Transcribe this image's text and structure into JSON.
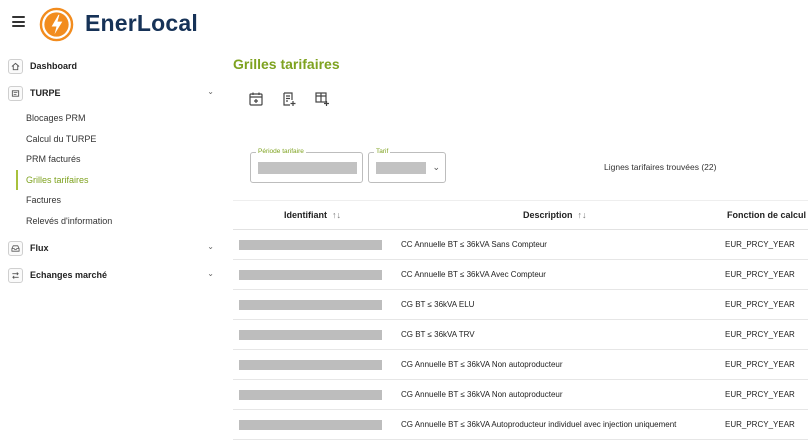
{
  "app": {
    "brand": "EnerLocal"
  },
  "sidebar": {
    "items": [
      {
        "label": "Dashboard",
        "icon": "home-icon"
      },
      {
        "label": "TURPE",
        "icon": "document-icon",
        "children": [
          "Blocages PRM",
          "Calcul du TURPE",
          "PRM facturés",
          "Grilles tarifaires",
          "Factures",
          "Relevés d'information"
        ],
        "active_child": "Grilles tarifaires"
      },
      {
        "label": "Flux",
        "icon": "inbox-icon"
      },
      {
        "label": "Echanges marché",
        "icon": "swap-arrows-icon"
      }
    ]
  },
  "page": {
    "title": "Grilles tarifaires",
    "toolbar": [
      "calendar-add-icon",
      "document-add-icon",
      "table-add-icon"
    ],
    "filters": {
      "periode_label": "Période tarifaire",
      "tarif_label": "Tarif"
    },
    "results_count": "Lignes tarifaires trouvées (22)"
  },
  "table": {
    "columns": [
      {
        "label": "Identifiant",
        "sortable": true
      },
      {
        "label": "Description",
        "sortable": true
      },
      {
        "label": "Fonction de calcul",
        "sortable": false
      }
    ],
    "sort_glyph": "↑↓",
    "rows": [
      {
        "description": "CC Annuelle BT ≤ 36kVA Sans Compteur",
        "fonction": "EUR_PRCY_YEAR"
      },
      {
        "description": "CC Annuelle BT ≤ 36kVA Avec Compteur",
        "fonction": "EUR_PRCY_YEAR"
      },
      {
        "description": "CG BT ≤ 36kVA ELU",
        "fonction": "EUR_PRCY_YEAR"
      },
      {
        "description": "CG BT ≤ 36kVA TRV",
        "fonction": "EUR_PRCY_YEAR"
      },
      {
        "description": "CG Annuelle BT ≤ 36kVA Non autoproducteur",
        "fonction": "EUR_PRCY_YEAR"
      },
      {
        "description": "CG Annuelle BT ≤ 36kVA Non autoproducteur",
        "fonction": "EUR_PRCY_YEAR"
      },
      {
        "description": "CG Annuelle BT ≤ 36kVA Autoproducteur individuel avec injection uniquement",
        "fonction": "EUR_PRCY_YEAR"
      }
    ]
  },
  "colors": {
    "accent": "#7ea21f",
    "brand": "#163257",
    "logo": "#f28c1e"
  }
}
